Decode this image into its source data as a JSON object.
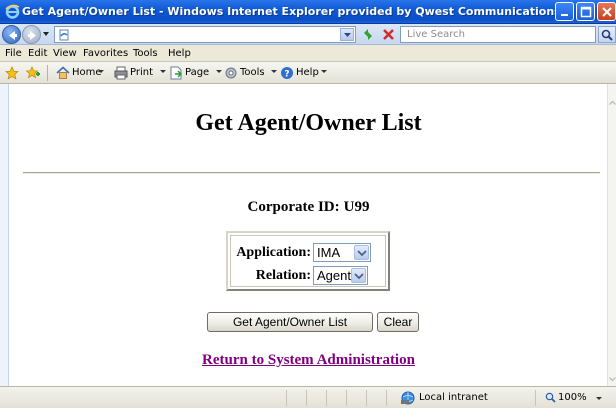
{
  "window": {
    "title": "Get Agent/Owner List - Windows Internet Explorer provided by Qwest Communications"
  },
  "address_bar": {
    "url": "",
    "search_placeholder": "Live Search"
  },
  "menu": {
    "items": [
      "File",
      "Edit",
      "View",
      "Favorites",
      "Tools",
      "Help"
    ]
  },
  "command_bar": {
    "home": "Home",
    "print": "Print",
    "page": "Page",
    "tools": "Tools",
    "help": "Help"
  },
  "page": {
    "heading": "Get Agent/Owner List",
    "corporate_id_label": "Corporate ID:",
    "corporate_id_value": "U99",
    "application_label": "Application:",
    "application_value": "IMA",
    "relation_label": "Relation:",
    "relation_value": "Agent",
    "get_button": "Get Agent/Owner List",
    "clear_button": "Clear",
    "return_link": "Return to System Administration",
    "link_color": "#800080"
  },
  "status_bar": {
    "zone": "Local intranet",
    "zoom": "100%"
  },
  "icons": {
    "browser": "ie-logo-icon",
    "back": "back-arrow-icon",
    "forward": "forward-arrow-icon",
    "refresh": "refresh-icon",
    "stop": "stop-icon",
    "search": "search-icon",
    "favorites": "favorites-star-icon",
    "add_favorites": "add-favorites-icon",
    "home": "home-icon",
    "print": "printer-icon",
    "page": "page-icon",
    "tools": "gear-icon",
    "help": "help-icon",
    "zone": "globe-icon",
    "zoom": "magnifier-icon"
  }
}
